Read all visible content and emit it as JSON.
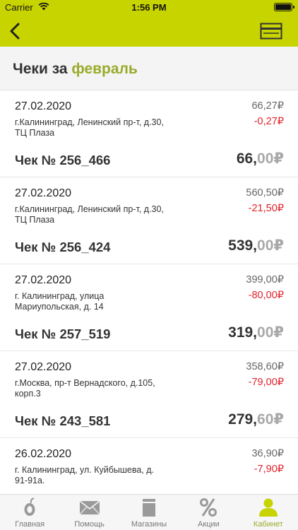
{
  "status_bar": {
    "carrier": "Carrier",
    "time": "1:56 PM"
  },
  "nav": {
    "back_icon": "chevron-left-icon",
    "card_icon": "card-icon"
  },
  "header": {
    "title_prefix": "Чеки за",
    "title_month": "февраль"
  },
  "receipts": [
    {
      "date": "27.02.2020",
      "address_line1": "г.Калининград, Ленинский пр-т, д.30,",
      "address_line2": "ТЦ Плаза",
      "total": "66,27₽",
      "discount": "-0,27₽",
      "number": "Чек № 256_466",
      "sum_int": "66,",
      "sum_frac": "00₽"
    },
    {
      "date": "27.02.2020",
      "address_line1": "г.Калининград, Ленинский пр-т, д.30,",
      "address_line2": "ТЦ Плаза",
      "total": "560,50₽",
      "discount": "-21,50₽",
      "number": "Чек № 256_424",
      "sum_int": "539,",
      "sum_frac": "00₽"
    },
    {
      "date": "27.02.2020",
      "address_line1": "г. Калининград, улица",
      "address_line2": "Мариупольская, д. 14",
      "total": "399,00₽",
      "discount": "-80,00₽",
      "number": "Чек № 257_519",
      "sum_int": "319,",
      "sum_frac": "00₽"
    },
    {
      "date": "27.02.2020",
      "address_line1": "г.Москва, пр-т Вернадского, д.105,",
      "address_line2": "корп.3",
      "total": "358,60₽",
      "discount": "-79,00₽",
      "number": "Чек № 243_581",
      "sum_int": "279,",
      "sum_frac": "60₽"
    },
    {
      "date": "26.02.2020",
      "address_line1": "г. Калининград, ул. Куйбышева, д.",
      "address_line2": "91-91а.",
      "total": "36,90₽",
      "discount": "-7,90₽",
      "number": "",
      "sum_int": "",
      "sum_frac": ""
    }
  ],
  "tabs": [
    {
      "label": "Главная",
      "icon": "home-logo-icon"
    },
    {
      "label": "Помощь",
      "icon": "envelope-icon"
    },
    {
      "label": "Магазины",
      "icon": "store-icon"
    },
    {
      "label": "Акции",
      "icon": "percent-icon"
    },
    {
      "label": "Кабинет",
      "icon": "user-icon",
      "active": true
    }
  ],
  "colors": {
    "accent": "#c8d400",
    "accent_text": "#9aaa2a",
    "discount": "#e0242c"
  }
}
